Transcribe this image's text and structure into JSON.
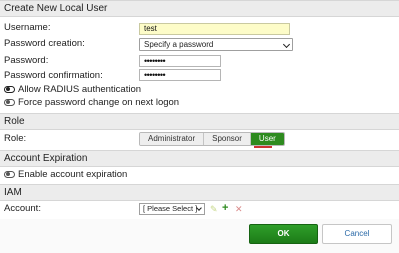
{
  "dialog": {
    "title": "Create New Local User"
  },
  "user": {
    "username_label": "Username:",
    "username_value": "test",
    "password_creation_label": "Password creation:",
    "password_creation_value": "Specify a password",
    "password_label": "Password:",
    "password_value": "••••••••",
    "password_confirm_label": "Password confirmation:",
    "password_confirm_value": "••••••••",
    "allow_radius_label": "Allow RADIUS authentication",
    "allow_radius_on": true,
    "force_change_label": "Force password change on next logon",
    "force_change_on": false
  },
  "role": {
    "section_title": "Role",
    "label": "Role:",
    "options": [
      "Administrator",
      "Sponsor",
      "User"
    ],
    "selected": "User"
  },
  "expiration": {
    "section_title": "Account Expiration",
    "enable_label": "Enable account expiration",
    "enabled": false
  },
  "iam": {
    "section_title": "IAM",
    "account_label": "Account:",
    "account_value": "[ Please Select ]"
  },
  "buttons": {
    "ok": "OK",
    "cancel": "Cancel"
  },
  "colors": {
    "accent_green": "#2e8b1f",
    "cancel_text": "#2b6aa8",
    "username_highlight": "#fdfcc8"
  }
}
